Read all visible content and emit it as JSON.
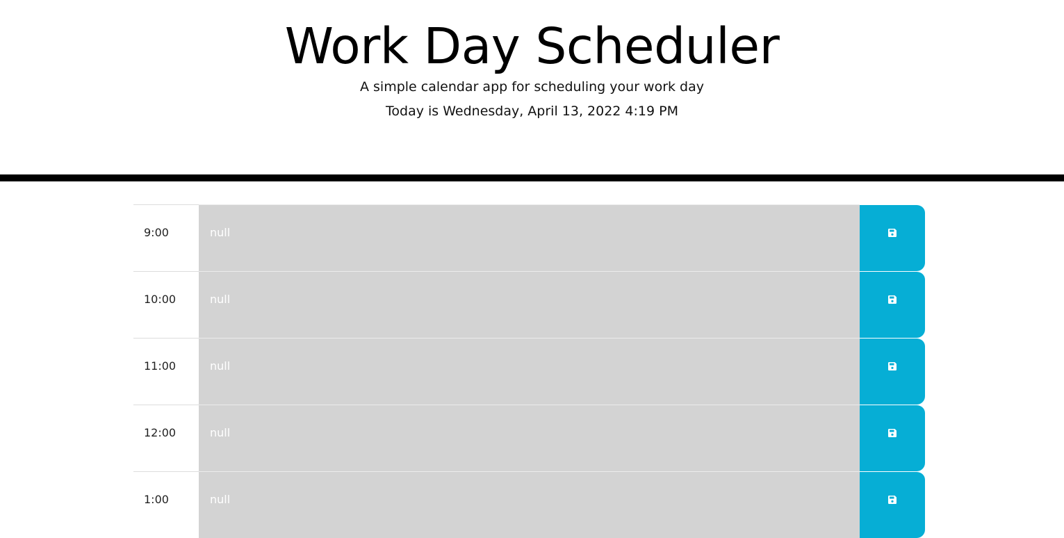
{
  "header": {
    "title": "Work Day Scheduler",
    "subtitle": "A simple calendar app for scheduling your work day",
    "current_day": "Today is Wednesday, April 13, 2022 4:19 PM"
  },
  "colors": {
    "past_block": "#d3d3d3",
    "save_button": "#06aed5",
    "divider": "#000000"
  },
  "timeblocks": [
    {
      "hour": "9:00",
      "description": "null",
      "save_icon": "floppy-disk-icon"
    },
    {
      "hour": "10:00",
      "description": "null",
      "save_icon": "floppy-disk-icon"
    },
    {
      "hour": "11:00",
      "description": "null",
      "save_icon": "floppy-disk-icon"
    },
    {
      "hour": "12:00",
      "description": "null",
      "save_icon": "floppy-disk-icon"
    },
    {
      "hour": "1:00",
      "description": "null",
      "save_icon": "floppy-disk-icon"
    }
  ]
}
